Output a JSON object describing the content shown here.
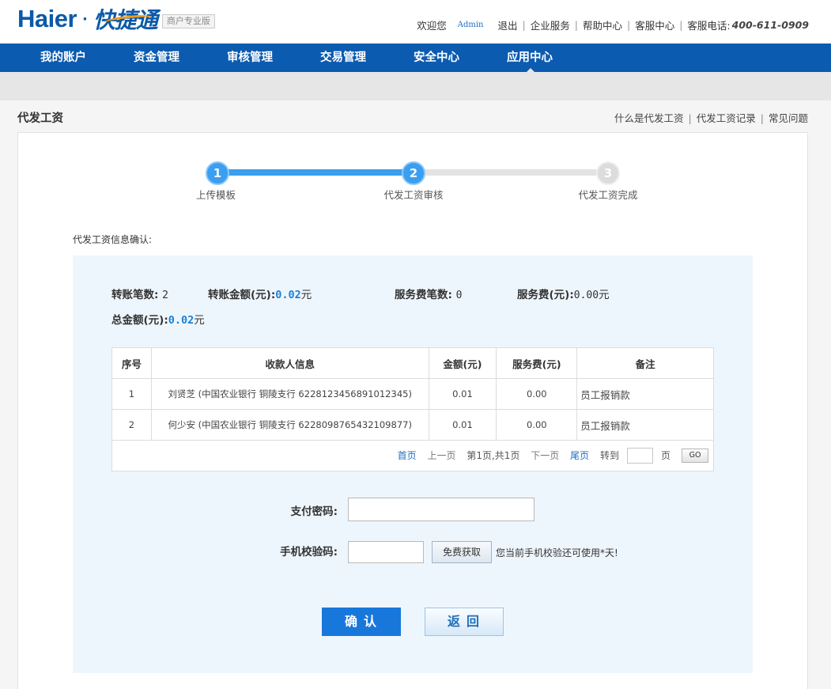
{
  "brand": {
    "logo_text": "Haier",
    "logo_dot": "·",
    "product_name": "快捷通",
    "edition_badge": "商户专业版"
  },
  "header": {
    "welcome": "欢迎您",
    "username": "Admin",
    "links": [
      "退出",
      "企业服务",
      "帮助中心",
      "客服中心"
    ],
    "phone_label": "客服电话:",
    "phone": "400-611-0909"
  },
  "nav": {
    "items": [
      "我的账户",
      "资金管理",
      "审核管理",
      "交易管理",
      "安全中心",
      "应用中心"
    ],
    "active_index": 5
  },
  "page": {
    "title": "代发工资",
    "links": [
      "什么是代发工资",
      "代发工资记录",
      "常见问题"
    ]
  },
  "steps": {
    "items": [
      {
        "number": "1",
        "label": "上传模板",
        "state": "done"
      },
      {
        "number": "2",
        "label": "代发工资审核",
        "state": "current"
      },
      {
        "number": "3",
        "label": "代发工资完成",
        "state": "todo"
      }
    ]
  },
  "confirm": {
    "title": "代发工资信息确认:",
    "transfer_count_label": "转账笔数:",
    "transfer_count": "2",
    "transfer_amount_label": "转账金额(元):",
    "transfer_amount": "0.02",
    "unit_yuan": "元",
    "fee_count_label": "服务费笔数:",
    "fee_count": "0",
    "fee_label": "服务费(元):",
    "fee": "0.00",
    "total_label": "总金额(元):",
    "total": "0.02"
  },
  "table": {
    "headers": [
      "序号",
      "收款人信息",
      "金额(元)",
      "服务费(元)",
      "备注"
    ],
    "rows": [
      {
        "index": "1",
        "payee": "刘贤芝 (中国农业银行  铜陵支行 6228123456891012345)",
        "amount": "0.01",
        "fee": "0.00",
        "remark": "员工报销款"
      },
      {
        "index": "2",
        "payee": "何少安 (中国农业银行  铜陵支行 6228098765432109877)",
        "amount": "0.01",
        "fee": "0.00",
        "remark": "员工报销款"
      }
    ]
  },
  "pager": {
    "first": "首页",
    "prev": "上一页",
    "info": "第1页,共1页",
    "next": "下一页",
    "last": "尾页",
    "goto": "转到",
    "page_unit": "页",
    "go": "GO"
  },
  "form": {
    "password_label": "支付密码:",
    "sms_label": "手机校验码:",
    "sms_button": "免费获取",
    "sms_tip": "您当前手机校验还可使用*天!"
  },
  "actions": {
    "confirm": "确认",
    "back": "返回"
  },
  "colors": {
    "brand_blue": "#0b5bb0",
    "accent_blue": "#1877db",
    "step_blue": "#3a9ff0",
    "panel_bg": "#eef6fd"
  }
}
